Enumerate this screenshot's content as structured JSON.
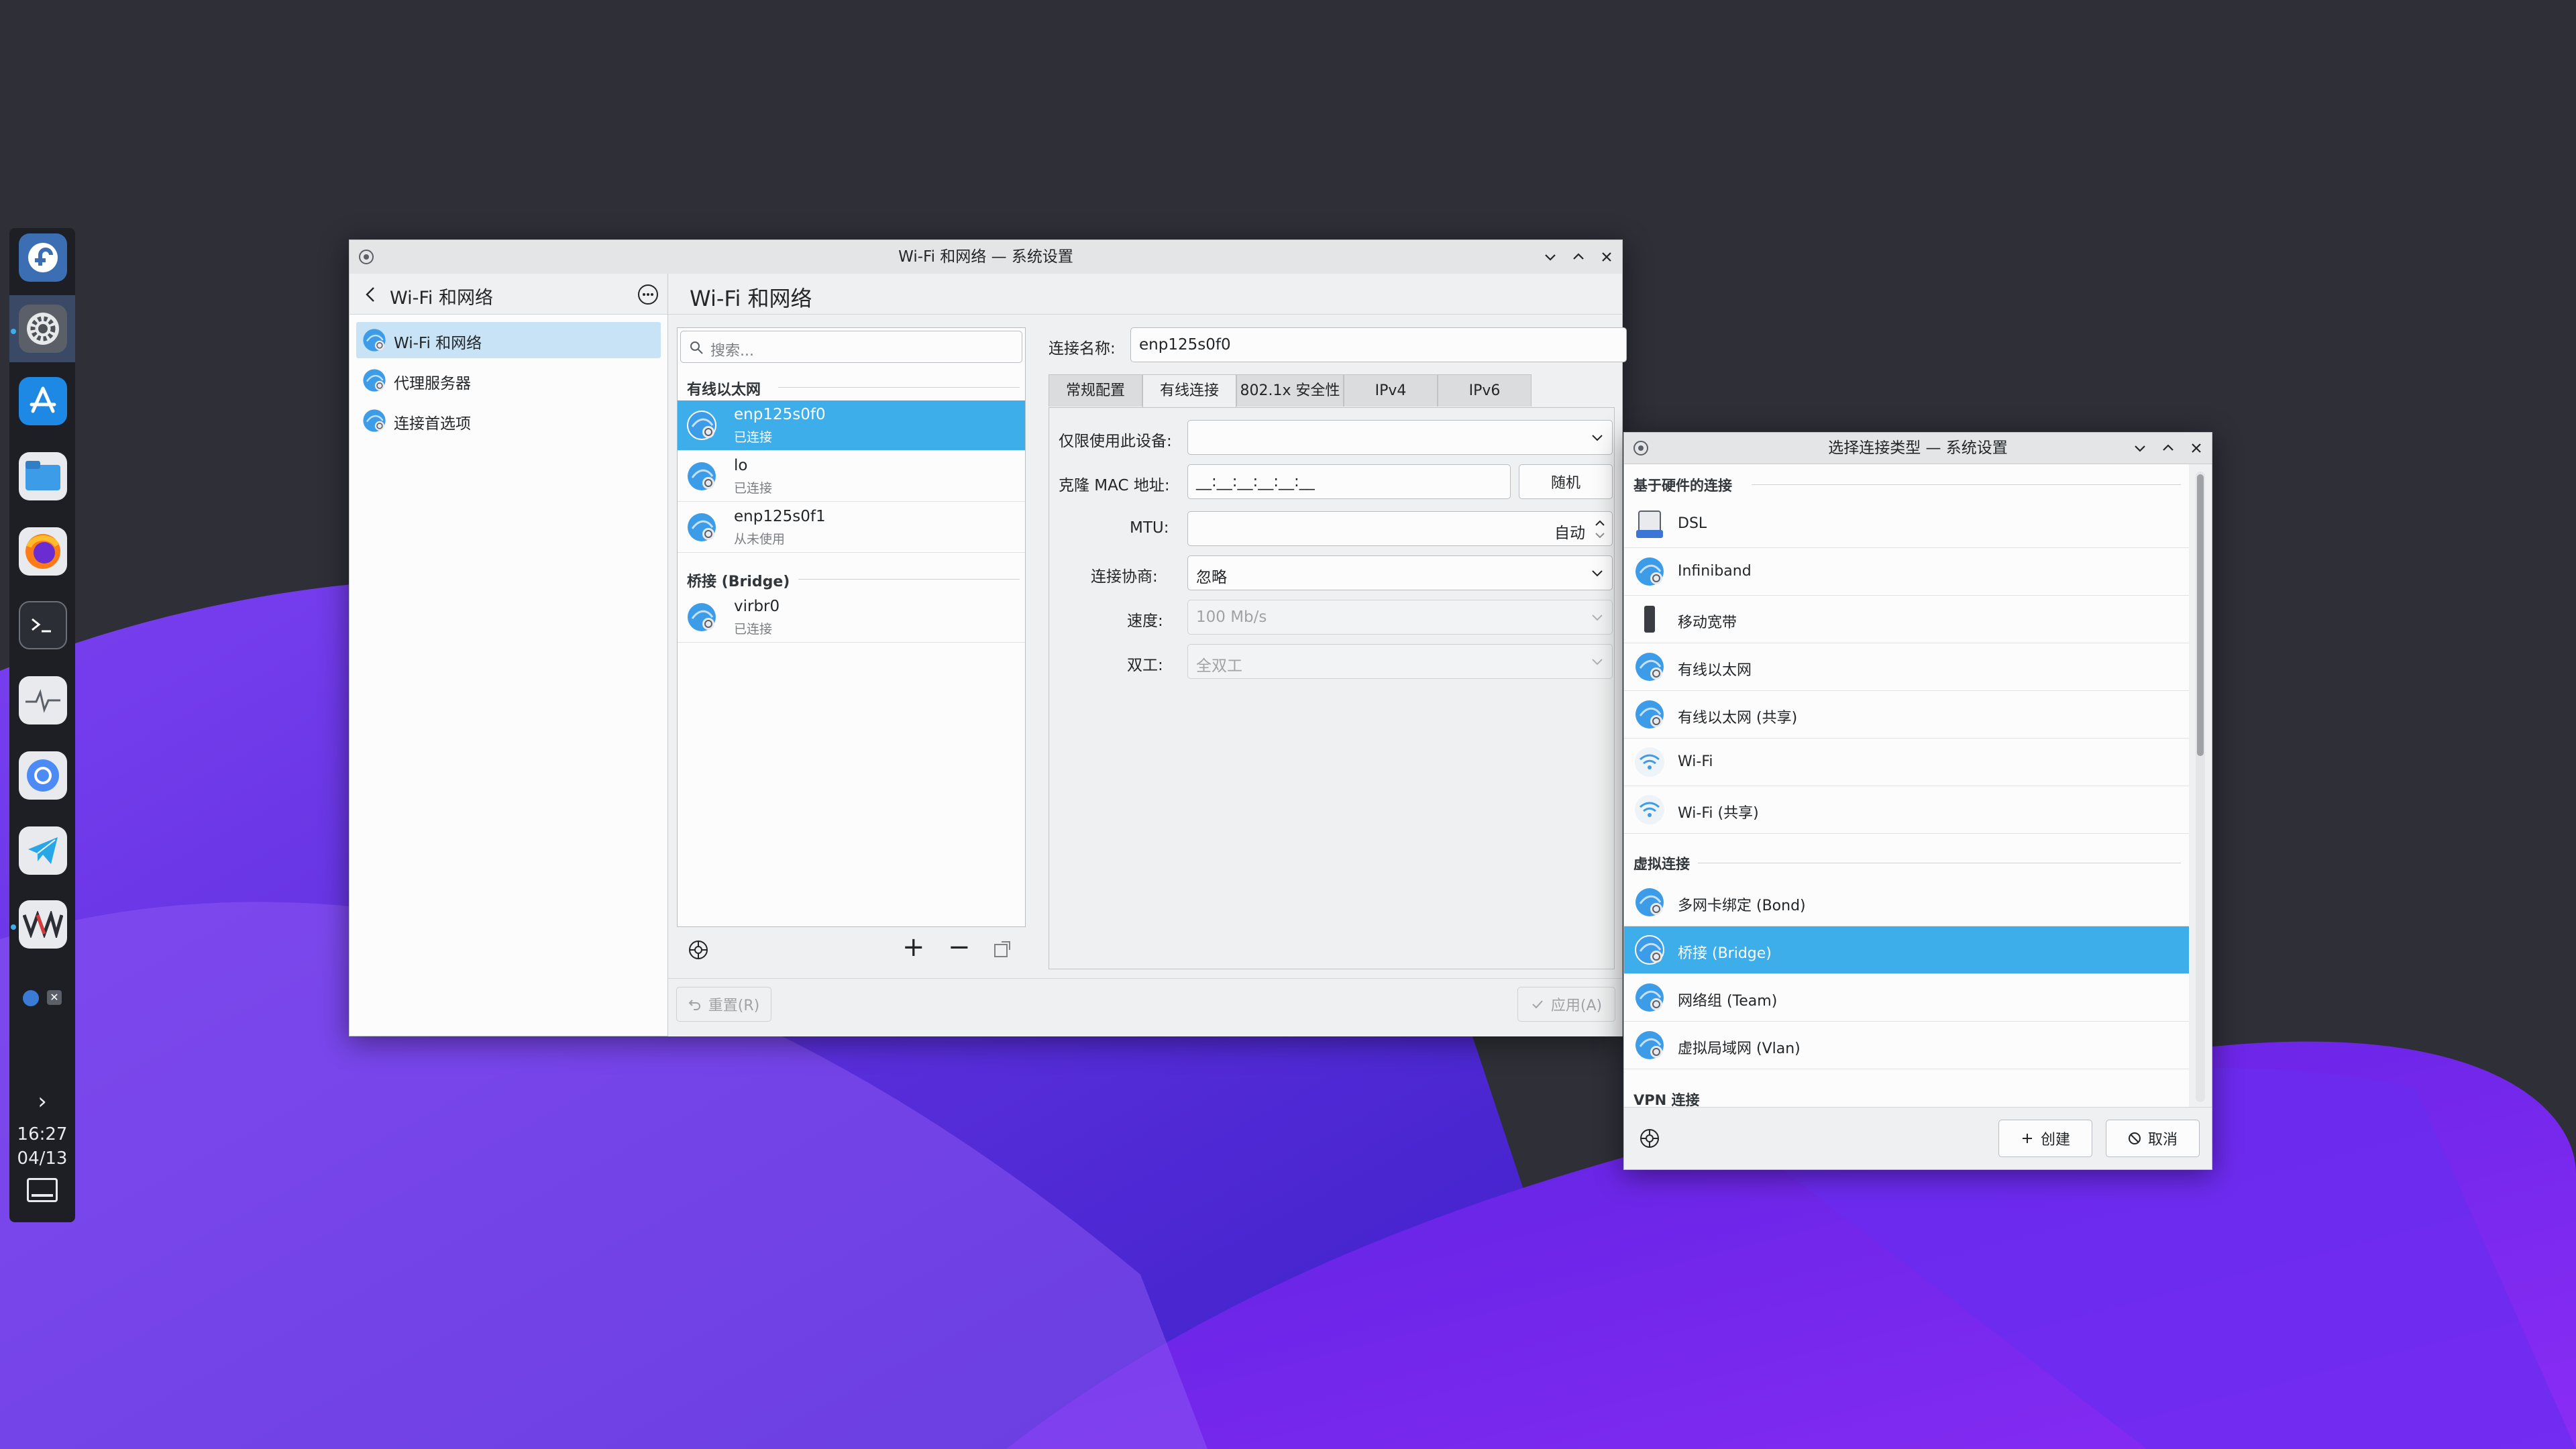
{
  "dock": {
    "items": [
      "fedora-icon",
      "settings-icon",
      "app-store-icon",
      "files-icon",
      "firefox-icon",
      "terminal-icon",
      "system-monitor-icon",
      "chromium-icon",
      "telegram-icon",
      "virt-manager-icon"
    ],
    "time": "16:27",
    "date": "04/13",
    "tray_expand": "›"
  },
  "main_window": {
    "title": "Wi-Fi 和网络 — 系统设置",
    "sidebar": {
      "back_title": "Wi-Fi 和网络",
      "items": [
        {
          "label": "Wi-Fi 和网络"
        },
        {
          "label": "代理服务器"
        },
        {
          "label": "连接首选项"
        }
      ]
    },
    "page_title": "Wi-Fi 和网络",
    "search_placeholder": "搜索...",
    "groups": {
      "ethernet": "有线以太网",
      "bridge": "桥接 (Bridge)"
    },
    "connections": [
      {
        "name": "enp125s0f0",
        "status": "已连接"
      },
      {
        "name": "lo",
        "status": "已连接"
      },
      {
        "name": "enp125s0f1",
        "status": "从未使用"
      },
      {
        "name": "virbr0",
        "status": "已连接"
      }
    ],
    "list_toolbar": {
      "add": "+",
      "remove": "−"
    },
    "detail": {
      "conn_name_label": "连接名称:",
      "conn_name_value": "enp125s0f0",
      "tabs": [
        "常规配置",
        "有线连接",
        "802.1x 安全性",
        "IPv4",
        "IPv6"
      ],
      "active_tab": "有线连接",
      "fields": {
        "device_label": "仅限使用此设备:",
        "device_value": "",
        "mac_label": "克隆 MAC 地址:",
        "mac_value": "__:__:__:__:__:__",
        "random_button": "随机",
        "mtu_label": "MTU:",
        "mtu_value": "自动",
        "negotiation_label": "连接协商:",
        "negotiation_value": "忽略",
        "speed_label": "速度:",
        "speed_value": "100 Mb/s",
        "duplex_label": "双工:",
        "duplex_value": "全双工"
      }
    },
    "footer": {
      "reset": "重置(R)",
      "apply": "应用(A)"
    }
  },
  "dialog": {
    "title": "选择连接类型 — 系统设置",
    "sections": [
      {
        "header": "基于硬件的连接",
        "items": [
          "DSL",
          "Infiniband",
          "移动宽带",
          "有线以太网",
          "有线以太网 (共享)",
          "Wi-Fi",
          "Wi-Fi (共享)"
        ]
      },
      {
        "header": "虚拟连接",
        "items": [
          "多网卡绑定 (Bond)",
          "桥接 (Bridge)",
          "网络组 (Team)",
          "虚拟局域网 (Vlan)"
        ]
      },
      {
        "header": "VPN 连接",
        "items": []
      }
    ],
    "selected": "桥接 (Bridge)",
    "create_button": "创建",
    "cancel_button": "取消"
  },
  "colors": {
    "accent": "#3daee9",
    "window_bg": "#eff0f1",
    "dock_bg": "#1d1f25"
  }
}
